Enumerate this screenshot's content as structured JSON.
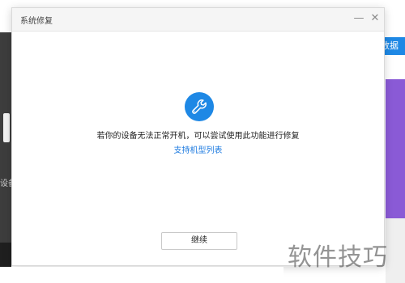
{
  "dialog": {
    "title": "系统修复",
    "minimize_glyph": "—",
    "close_glyph": "✕",
    "icon": "wrench-icon",
    "message": "若你的设备无法正常开机，可以尝试使用此功能进行修复",
    "link_text": "支持机型列表",
    "continue_label": "继续"
  },
  "background": {
    "left_text": "设备",
    "right_button_text": "数据"
  },
  "watermark": "软件技巧",
  "colors": {
    "accent": "#1e88e5",
    "link": "#1e7be0",
    "purple_panel": "#8a5ad6"
  }
}
